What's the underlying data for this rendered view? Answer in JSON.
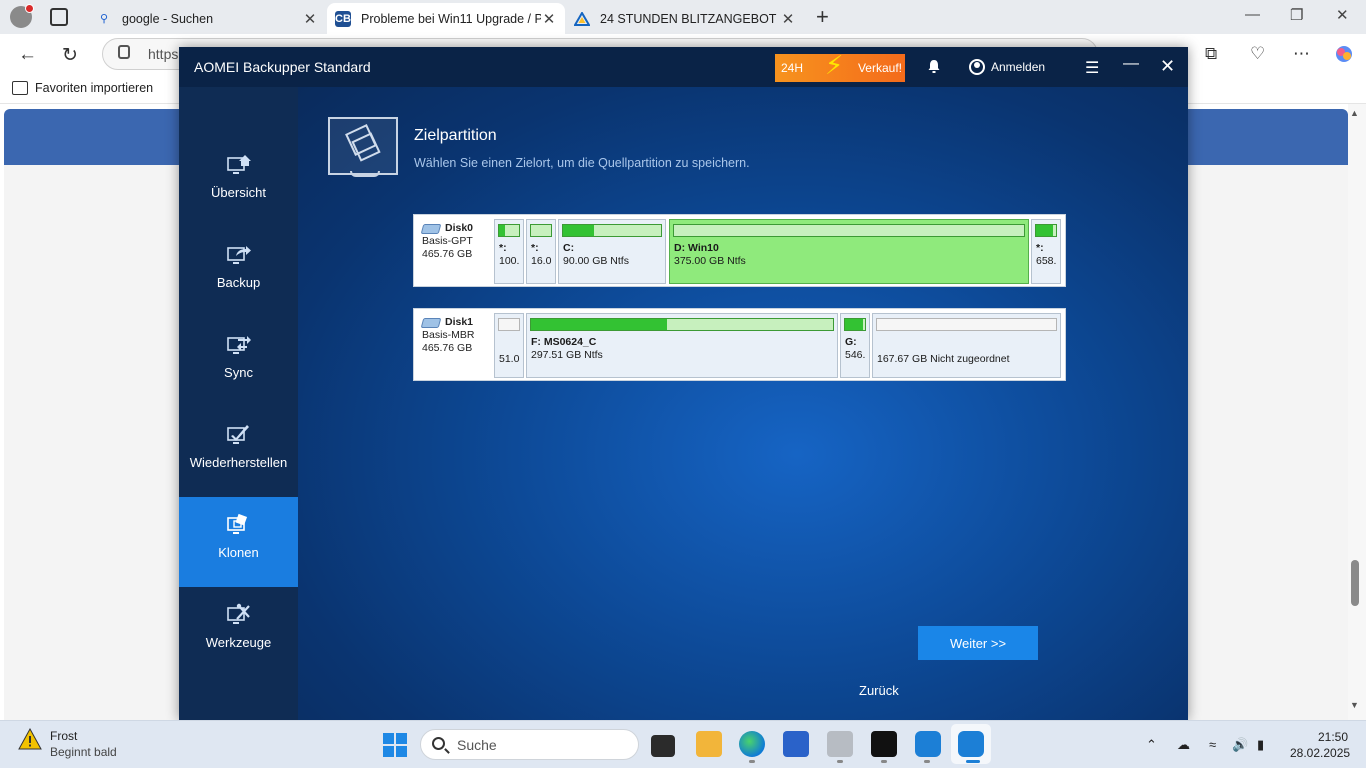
{
  "browser": {
    "tabs": [
      {
        "title": "google - Suchen",
        "favicon": "search-icon"
      },
      {
        "title": "Probleme bei Win11 Upgrade / PC",
        "favicon": "cb-logo"
      },
      {
        "title": "24 STUNDEN BLITZANGEBOT | BIS",
        "favicon": "triangle-logo"
      }
    ],
    "url_visible": "https",
    "favorites_import": "Favoriten importieren"
  },
  "app": {
    "title": "AOMEI Backupper Standard",
    "promo_left": "24H",
    "promo_right": "Verkauf!",
    "login": "Anmelden",
    "nav": [
      {
        "label": "Übersicht",
        "icon": "home-monitor-icon"
      },
      {
        "label": "Backup",
        "icon": "backup-icon"
      },
      {
        "label": "Sync",
        "icon": "sync-icon"
      },
      {
        "label": "Wiederherstellen",
        "icon": "restore-icon"
      },
      {
        "label": "Klonen",
        "icon": "clone-icon"
      },
      {
        "label": "Werkzeuge",
        "icon": "tools-icon"
      }
    ],
    "selected_nav": "Klonen",
    "page_title": "Zielpartition",
    "page_subtitle": "Wählen Sie einen Zielort, um die Quellpartition zu speichern.",
    "disks": [
      {
        "name": "Disk0",
        "type": "Basis-GPT",
        "size": "465.76 GB",
        "partitions": [
          {
            "name": "*:",
            "detail": "100.",
            "used": 0.3
          },
          {
            "name": "*:",
            "detail": "16.0",
            "used": 0
          },
          {
            "name": "C:",
            "detail": "90.00 GB Ntfs",
            "used": 0.32
          },
          {
            "name": "D: Win10",
            "detail": "375.00 GB Ntfs",
            "used": 0,
            "selected": true
          },
          {
            "name": "*:",
            "detail": "658.",
            "used": 0.85
          }
        ]
      },
      {
        "name": "Disk1",
        "type": "Basis-MBR",
        "size": "465.76 GB",
        "partitions": [
          {
            "name": "",
            "detail": "51.0",
            "used": 0,
            "empty": true
          },
          {
            "name": "F: MS0624_C",
            "detail": "297.51 GB Ntfs",
            "used": 0.45
          },
          {
            "name": "G:",
            "detail": "546.",
            "used": 0.9
          },
          {
            "name": "",
            "detail": "167.67 GB Nicht zugeordnet",
            "used": 0,
            "empty": true
          }
        ]
      }
    ],
    "back_label": "Zurück",
    "next_label": "Weiter >>"
  },
  "taskbar": {
    "weather_title": "Frost",
    "weather_sub": "Beginnt bald",
    "search_placeholder": "Suche",
    "time": "21:50",
    "date": "28.02.2025"
  },
  "colors": {
    "accent": "#1a86e8",
    "sidebar_selected": "#1a7de0",
    "partition_selected": "#8fea7c",
    "used_fill": "#33c233"
  }
}
